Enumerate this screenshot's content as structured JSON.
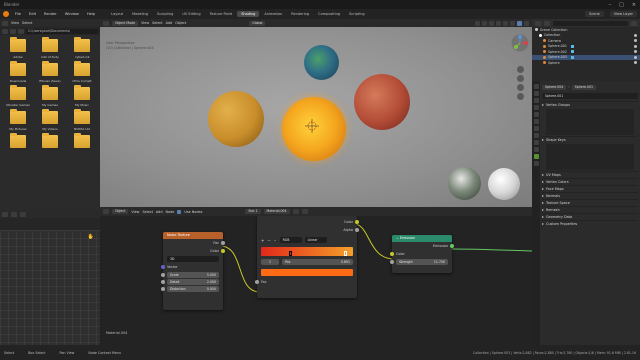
{
  "window": {
    "title": "Blender"
  },
  "menu": [
    "File",
    "Edit",
    "Render",
    "Window",
    "Help"
  ],
  "workspaces": {
    "tabs": [
      "Layout",
      "Modeling",
      "Sculpting",
      "UV Editing",
      "Texture Paint",
      "Shading",
      "Animation",
      "Rendering",
      "Compositing",
      "Scripting"
    ],
    "active_index": 5
  },
  "topbar_right": {
    "scene": "Scene",
    "view_layer": "View Layer"
  },
  "file_browser": {
    "menu": [
      "View",
      "Select"
    ],
    "path": "C:\\Users\\pixel\\Documents\\",
    "folders": [
      "Adobe",
      "Call of Duty",
      "CyberLink",
      "Downloads",
      "Elbows (Save)",
      "LTCG Complt",
      "Monster Games",
      "My Games",
      "My Music",
      "My Pictures",
      "My Videos",
      "NVIDIA Ltd",
      "",
      "",
      ""
    ]
  },
  "viewport": {
    "mode": "Object Mode",
    "menu": [
      "View",
      "Select",
      "Add",
      "Object"
    ],
    "overlay_line1": "User Perspective",
    "overlay_line2": "(10) Collection | Sphere.004",
    "shading": "Global"
  },
  "node_editor": {
    "menu": [
      "Object",
      "View",
      "Select",
      "Add",
      "Node"
    ],
    "use_nodes": "Use Nodes",
    "slot": "Slot 1",
    "material": "Material.004",
    "material_label": "Material.004",
    "noise_node": {
      "title": "Noise Texture",
      "out_fac": "Fac",
      "out_color": "Color",
      "dimension": "3D",
      "in_vector": "Vector",
      "scale_label": "Scale",
      "scale_value": "5.000",
      "detail_label": "Detail",
      "detail_value": "2.000",
      "distortion_label": "Distortion",
      "distortion_value": "0.000"
    },
    "ramp_node": {
      "out_color": "Color",
      "out_alpha": "Alpha",
      "color_mode": "RGB",
      "interpolation": "Linear",
      "index": "1",
      "pos_label": "Pos",
      "pos_value": "0.891",
      "in_fac": "Fac"
    },
    "emission_node": {
      "title": "Emission",
      "out_emission": "Emission",
      "in_color": "Color",
      "strength_label": "Strength",
      "strength_value": "11.700"
    }
  },
  "outliner": {
    "header": "Scene Collection",
    "rows": [
      "Scene Collection",
      "Collection",
      "Camera",
      "Sphere.001",
      "Sphere.002",
      "Sphere.003",
      "Sphere"
    ],
    "selected_index": 5
  },
  "properties": {
    "object_chip": "Sphere.004",
    "mesh_chip": "Sphere.001",
    "field": "Sphere.001",
    "sections": [
      "Vertex Groups",
      "Shape Keys",
      "UV Maps",
      "Vertex Colors",
      "Face Maps",
      "Normals",
      "Texture Space",
      "Remesh",
      "Geometry Data",
      "Custom Properties"
    ]
  },
  "statusbar": {
    "left": [
      "Select",
      "Box Select",
      "Pan View",
      "Node Context Menu"
    ],
    "right": "Collection | Sphere.003 | Verts:2,882 | Faces:2,880 | Tris:5,760 | Objects:1/6 | Mem: 91.6 MiB | 2.81.16"
  },
  "colors": {
    "accent": "#e87d0d",
    "noise_header": "#b7602a",
    "emission_header": "#2b8a6b",
    "ramp_left": "#e2281a",
    "ramp_right": "#f5a02a",
    "ramp_output": "#ff6a14"
  }
}
